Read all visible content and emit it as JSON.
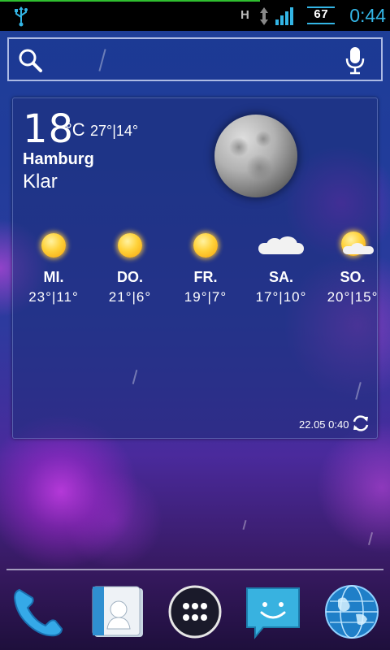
{
  "status_bar": {
    "network_type": "H",
    "battery_level": "67",
    "clock": "0:44",
    "accent_color": "#33b5e5",
    "icons": [
      "usb-icon",
      "data-transfer-icon",
      "signal-icon",
      "battery-icon"
    ]
  },
  "search": {
    "icons": [
      "search-icon",
      "mic-icon"
    ]
  },
  "weather": {
    "current_temp": "18",
    "unit": "°C",
    "high_low": "27°|14°",
    "city": "Hamburg",
    "condition": "Klar",
    "condition_icon": "moon-icon",
    "forecast": [
      {
        "day": "MI.",
        "temps": "23°|11°",
        "icon": "sun-icon"
      },
      {
        "day": "DO.",
        "temps": "21°|6°",
        "icon": "sun-icon"
      },
      {
        "day": "FR.",
        "temps": "19°|7°",
        "icon": "sun-icon"
      },
      {
        "day": "SA.",
        "temps": "17°|10°",
        "icon": "cloud-icon"
      },
      {
        "day": "SO.",
        "temps": "20°|15°",
        "icon": "sun-cloud-icon"
      }
    ],
    "updated": "22.05 0:40"
  },
  "dock": {
    "apps": [
      "phone-icon",
      "contacts-icon",
      "all-apps-icon",
      "messaging-icon",
      "browser-icon"
    ]
  }
}
